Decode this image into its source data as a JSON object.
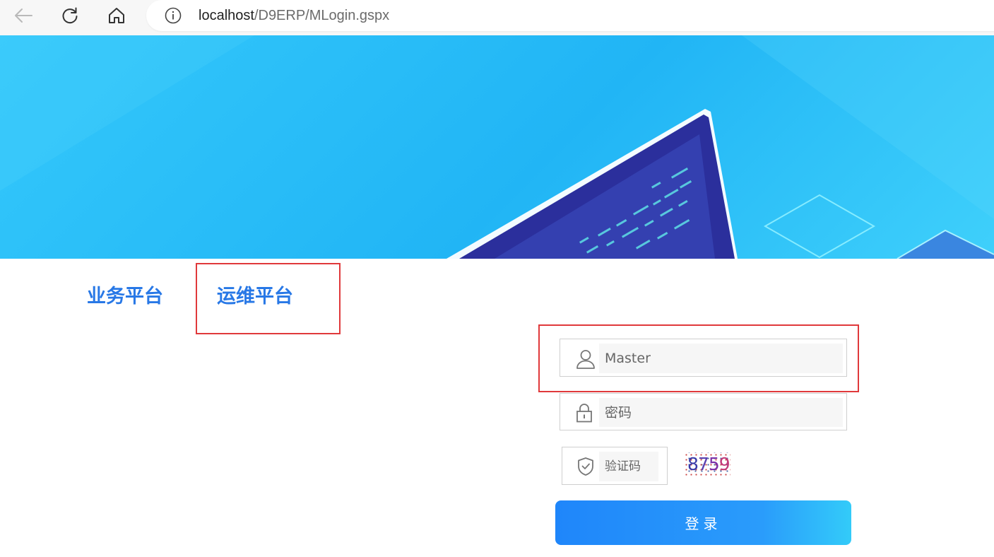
{
  "browser": {
    "url_host": "localhost",
    "url_path": "/D9ERP/MLogin.gspx",
    "icons": [
      "back-arrow-icon",
      "reload-icon",
      "home-icon",
      "info-icon"
    ]
  },
  "tabs": {
    "business": "业务平台",
    "ops": "运维平台"
  },
  "form": {
    "username_value": "Master",
    "password_placeholder": "密码",
    "captcha_placeholder": "验证码",
    "captcha_digits": [
      "8",
      "7",
      "5",
      "9"
    ],
    "login_label": "登录",
    "icons": [
      "user-icon",
      "lock-icon",
      "shield-check-icon"
    ]
  },
  "colors": {
    "accent": "#2878e6",
    "highlight": "#e0393b",
    "banner": "#21b5f5"
  }
}
